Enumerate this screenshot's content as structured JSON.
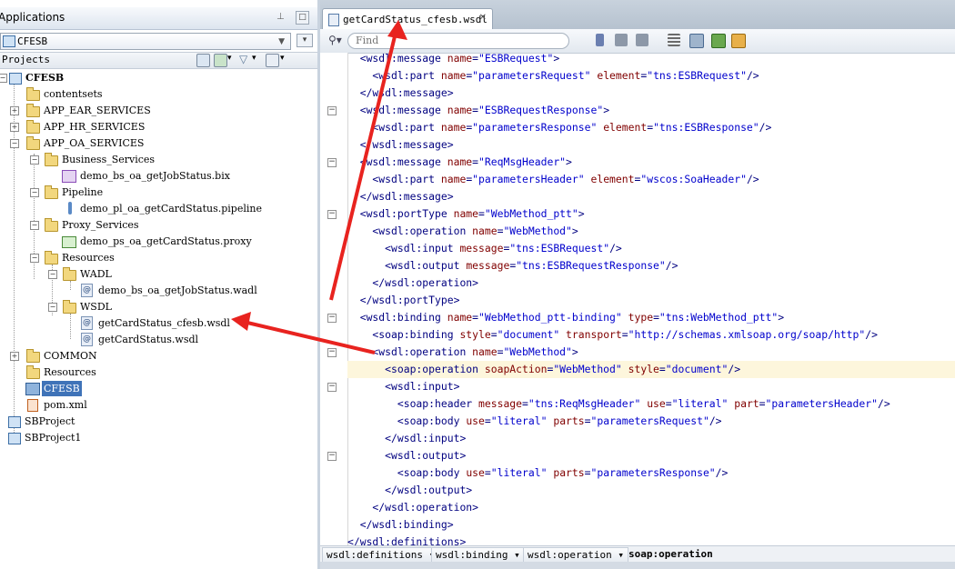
{
  "left_panel": {
    "title": "Applications",
    "app_selector": "CFESB",
    "projects_label": "Projects"
  },
  "tree": [
    {
      "label": "CFESB",
      "kind": "project"
    },
    {
      "label": "contentsets",
      "kind": "folder"
    },
    {
      "label": "APP_EAR_SERVICES",
      "kind": "folder"
    },
    {
      "label": "APP_HR_SERVICES",
      "kind": "folder"
    },
    {
      "label": "APP_OA_SERVICES",
      "kind": "folder"
    },
    {
      "label": "Business_Services",
      "kind": "folder"
    },
    {
      "label": "demo_bs_oa_getJobStatus.bix",
      "kind": "bix"
    },
    {
      "label": "Pipeline",
      "kind": "folder"
    },
    {
      "label": "demo_pl_oa_getCardStatus.pipeline",
      "kind": "pipeline"
    },
    {
      "label": "Proxy_Services",
      "kind": "folder"
    },
    {
      "label": "demo_ps_oa_getCardStatus.proxy",
      "kind": "proxy"
    },
    {
      "label": "Resources",
      "kind": "folder"
    },
    {
      "label": "WADL",
      "kind": "folder"
    },
    {
      "label": "demo_bs_oa_getJobStatus.wadl",
      "kind": "file"
    },
    {
      "label": "WSDL",
      "kind": "folder"
    },
    {
      "label": "getCardStatus_cfesb.wsdl",
      "kind": "file"
    },
    {
      "label": "getCardStatus.wsdl",
      "kind": "file"
    },
    {
      "label": "COMMON",
      "kind": "folder"
    },
    {
      "label": "Resources",
      "kind": "folder"
    },
    {
      "label": "CFESB",
      "kind": "config",
      "selected": true
    },
    {
      "label": "pom.xml",
      "kind": "pom"
    },
    {
      "label": "SBProject",
      "kind": "sbproject"
    },
    {
      "label": "SBProject1",
      "kind": "sbproject"
    }
  ],
  "editor": {
    "tab_label": "getCardStatus_cfesb.wsdl",
    "find_placeholder": "Find",
    "code_lines": [
      "  <wsdl:message name=\"ESBRequest\">",
      "    <wsdl:part name=\"parametersRequest\" element=\"tns:ESBRequest\"/>",
      "  </wsdl:message>",
      "  <wsdl:message name=\"ESBRequestResponse\">",
      "    <wsdl:part name=\"parametersResponse\" element=\"tns:ESBResponse\"/>",
      "  </wsdl:message>",
      "  <wsdl:message name=\"ReqMsgHeader\">",
      "    <wsdl:part name=\"parametersHeader\" element=\"wscos:SoaHeader\"/>",
      "  </wsdl:message>",
      "  <wsdl:portType name=\"WebMethod_ptt\">",
      "    <wsdl:operation name=\"WebMethod\">",
      "      <wsdl:input message=\"tns:ESBRequest\"/>",
      "      <wsdl:output message=\"tns:ESBRequestResponse\"/>",
      "    </wsdl:operation>",
      "  </wsdl:portType>",
      "  <wsdl:binding name=\"WebMethod_ptt-binding\" type=\"tns:WebMethod_ptt\">",
      "    <soap:binding style=\"document\" transport=\"http://schemas.xmlsoap.org/soap/http\"/>",
      "    <wsdl:operation name=\"WebMethod\">",
      "      <soap:operation soapAction=\"WebMethod\" style=\"document\"/>",
      "      <wsdl:input>",
      "        <soap:header message=\"tns:ReqMsgHeader\" use=\"literal\" part=\"parametersHeader\"/>",
      "        <soap:body use=\"literal\" parts=\"parametersRequest\"/>",
      "      </wsdl:input>",
      "      <wsdl:output>",
      "        <soap:body use=\"literal\" parts=\"parametersResponse\"/>",
      "      </wsdl:output>",
      "    </wsdl:operation>",
      "  </wsdl:binding>",
      "</wsdl:definitions>"
    ],
    "breadcrumb": [
      "wsdl:definitions",
      "wsdl:binding",
      "wsdl:operation",
      "soap:operation"
    ]
  },
  "colors": {
    "selection": "#3f73b8",
    "highlight_line": "#fdf6dc",
    "annotation_arrow": "#e8231f"
  }
}
